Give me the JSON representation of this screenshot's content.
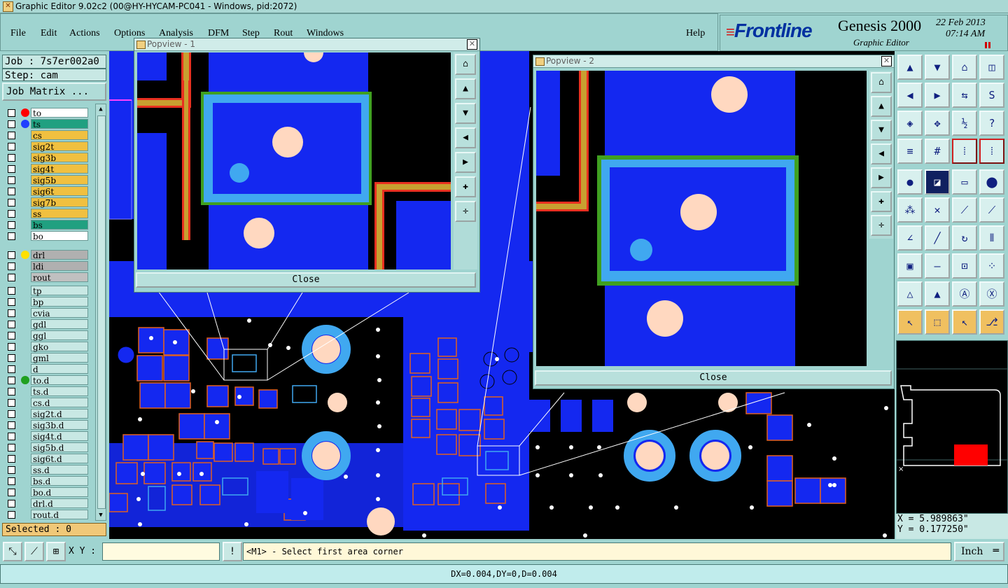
{
  "window": {
    "title": "Graphic Editor 9.02c2 (00@HY-HYCAM-PC041 - Windows, pid:2072)"
  },
  "menu": {
    "items": [
      "File",
      "Edit",
      "Actions",
      "Options",
      "Analysis",
      "DFM",
      "Step",
      "Rout",
      "Windows"
    ],
    "help": "Help"
  },
  "brand": {
    "logo": "Frontline",
    "product": "Genesis 2000",
    "subtitle": "Graphic Editor",
    "date": "22 Feb 2013",
    "time": "07:14 AM"
  },
  "job": {
    "job_label": "Job : 7s7er002a0",
    "step_label": "Step: cam",
    "matrix_button": "Job Matrix ..."
  },
  "layers": [
    {
      "name": "to",
      "bg": "#ffffff",
      "dot": "#ff0000",
      "group": 0
    },
    {
      "name": "ts",
      "bg": "#20a080",
      "dot": "#2040ff",
      "group": 0
    },
    {
      "name": "cs",
      "bg": "#f0c040",
      "dot": "",
      "group": 0
    },
    {
      "name": "sig2t",
      "bg": "#f0c040",
      "dot": "",
      "group": 0
    },
    {
      "name": "sig3b",
      "bg": "#f0c040",
      "dot": "",
      "group": 0
    },
    {
      "name": "sig4t",
      "bg": "#f0c040",
      "dot": "",
      "group": 0
    },
    {
      "name": "sig5b",
      "bg": "#f0c040",
      "dot": "",
      "group": 0
    },
    {
      "name": "sig6t",
      "bg": "#f0c040",
      "dot": "",
      "group": 0
    },
    {
      "name": "sig7b",
      "bg": "#f0c040",
      "dot": "",
      "group": 0
    },
    {
      "name": "ss",
      "bg": "#f0c040",
      "dot": "",
      "group": 0
    },
    {
      "name": "bs",
      "bg": "#20a080",
      "dot": "",
      "group": 0
    },
    {
      "name": "bo",
      "bg": "#ffffff",
      "dot": "",
      "group": 0
    },
    {
      "name": "drl",
      "bg": "#b0b0b0",
      "dot": "#ffe000",
      "group": 1
    },
    {
      "name": "ldi",
      "bg": "#b0b0b0",
      "dot": "",
      "group": 1
    },
    {
      "name": "rout",
      "bg": "#c0c0c0",
      "dot": "",
      "group": 1
    },
    {
      "name": "tp",
      "bg": "#c8e8e4",
      "dot": "",
      "group": 2
    },
    {
      "name": "bp",
      "bg": "#c8e8e4",
      "dot": "",
      "group": 2
    },
    {
      "name": "cvia",
      "bg": "#c8e8e4",
      "dot": "",
      "group": 2
    },
    {
      "name": "gdl",
      "bg": "#c8e8e4",
      "dot": "",
      "group": 2
    },
    {
      "name": "ggl",
      "bg": "#c8e8e4",
      "dot": "",
      "group": 2
    },
    {
      "name": "gko",
      "bg": "#c8e8e4",
      "dot": "",
      "group": 2
    },
    {
      "name": "gml",
      "bg": "#c8e8e4",
      "dot": "",
      "group": 2
    },
    {
      "name": "d",
      "bg": "#c8e8e4",
      "dot": "",
      "group": 2
    },
    {
      "name": "to.d",
      "bg": "#c8e8e4",
      "dot": "#20a020",
      "group": 2
    },
    {
      "name": "ts.d",
      "bg": "#c8e8e4",
      "dot": "",
      "group": 2
    },
    {
      "name": "cs.d",
      "bg": "#c8e8e4",
      "dot": "",
      "group": 2
    },
    {
      "name": "sig2t.d",
      "bg": "#c8e8e4",
      "dot": "",
      "group": 2
    },
    {
      "name": "sig3b.d",
      "bg": "#c8e8e4",
      "dot": "",
      "group": 2
    },
    {
      "name": "sig4t.d",
      "bg": "#c8e8e4",
      "dot": "",
      "group": 2
    },
    {
      "name": "sig5b.d",
      "bg": "#c8e8e4",
      "dot": "",
      "group": 2
    },
    {
      "name": "sig6t.d",
      "bg": "#c8e8e4",
      "dot": "",
      "group": 2
    },
    {
      "name": "ss.d",
      "bg": "#c8e8e4",
      "dot": "",
      "group": 2
    },
    {
      "name": "bs.d",
      "bg": "#c8e8e4",
      "dot": "",
      "group": 2
    },
    {
      "name": "bo.d",
      "bg": "#c8e8e4",
      "dot": "",
      "group": 2
    },
    {
      "name": "drl.d",
      "bg": "#c8e8e4",
      "dot": "",
      "group": 2
    },
    {
      "name": "rout.d",
      "bg": "#c8e8e4",
      "dot": "",
      "group": 2
    }
  ],
  "selected": "Selected : 0",
  "popview1": {
    "title": "Popview - 1",
    "close": "Close"
  },
  "popview2": {
    "title": "Popview - 2",
    "close": "Close"
  },
  "coords": {
    "x": "X = 5.989863\"",
    "y": "Y = 0.177250\""
  },
  "bottom": {
    "xy_label": "X Y :",
    "xy_value": "",
    "prompt": "<M1> - Select first area corner",
    "units": "Inch"
  },
  "status": "DX=0.004,DY=0,D=0.004",
  "colors": {
    "board": "#1428f0",
    "copper_light": "#40a8f0",
    "pad": "#ffd8c0",
    "outline": "#e06020"
  }
}
